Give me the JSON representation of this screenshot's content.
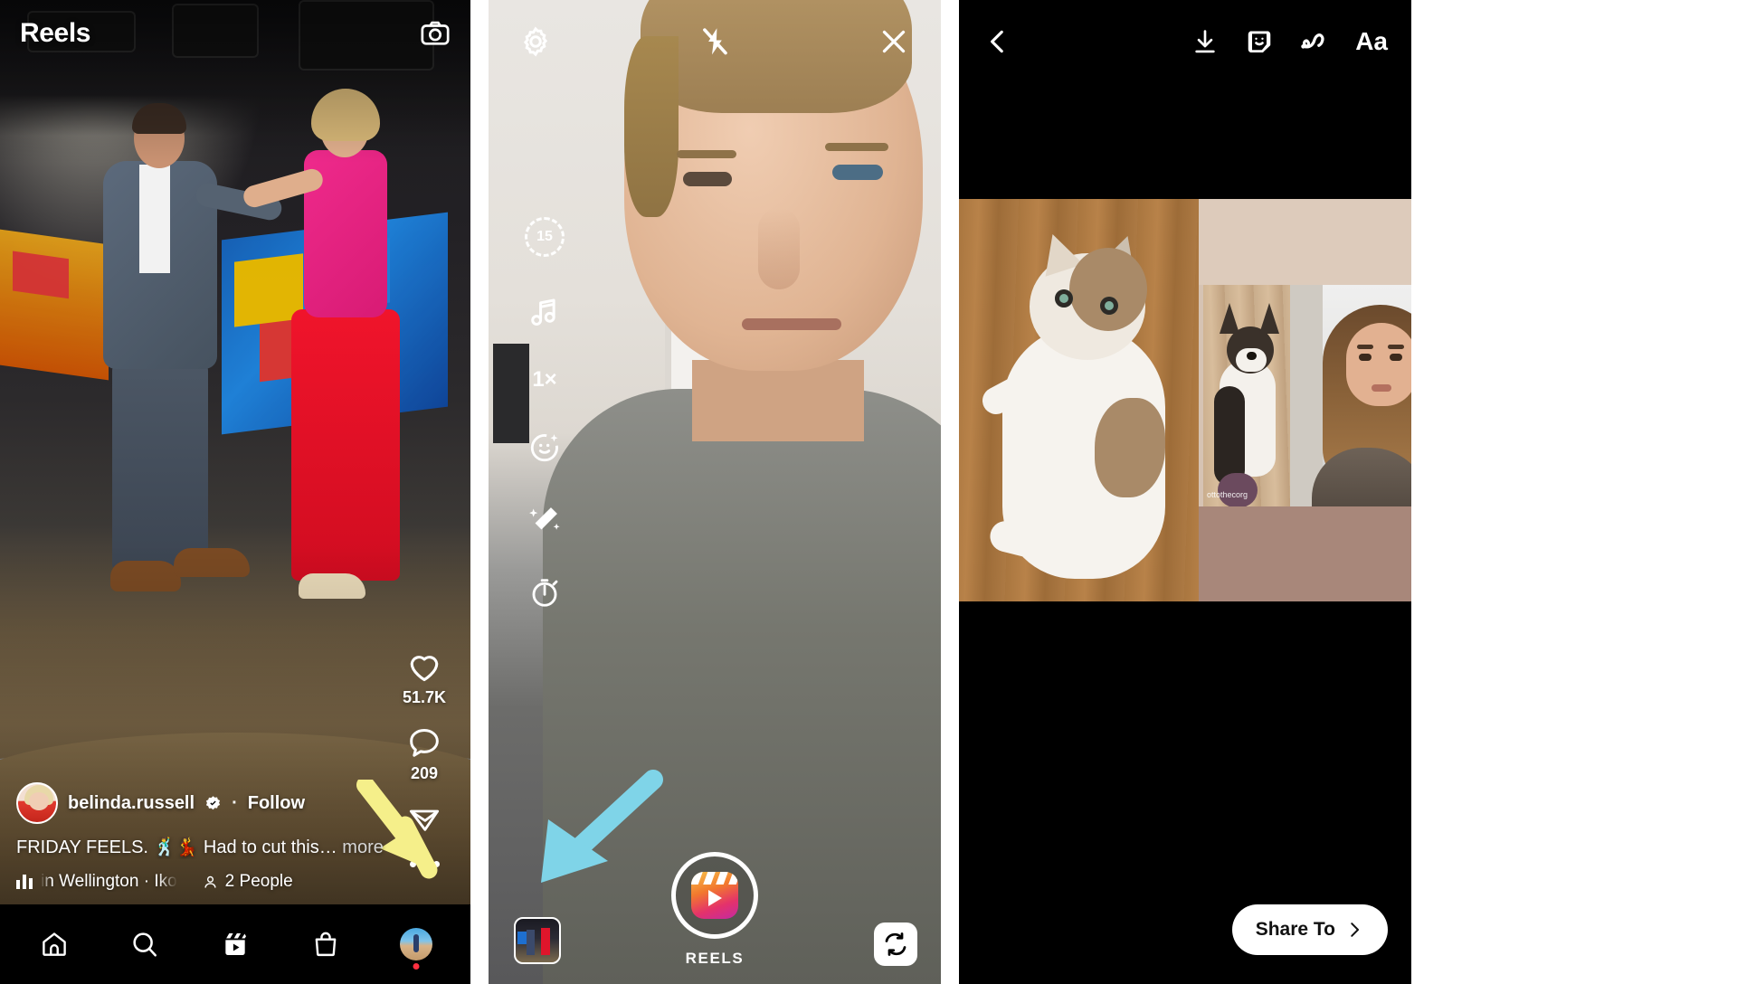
{
  "feed": {
    "title": "Reels",
    "camera_icon": "camera-icon",
    "post": {
      "username": "belinda.russell",
      "verified_icon": "verified-badge-icon",
      "separator": "·",
      "follow_label": "Follow",
      "caption": "FRIDAY FEELS. 🕺💃 Had to cut this… ",
      "caption_more": "more",
      "audio_text": "in Wellington · Iko",
      "audio_icon": "audio-equalizer-icon",
      "people_tag": "2 People",
      "people_icon": "person-icon"
    },
    "actions": {
      "like_icon": "heart-icon",
      "like_count": "51.7K",
      "comment_icon": "comment-bubble-icon",
      "comment_count": "209",
      "share_icon": "share-paper-plane-icon",
      "more_icon": "more-options-dots-icon"
    },
    "tabbar": [
      {
        "name": "home",
        "icon": "home-icon"
      },
      {
        "name": "search",
        "icon": "search-icon"
      },
      {
        "name": "reels",
        "icon": "reels-icon"
      },
      {
        "name": "shop",
        "icon": "shop-bag-icon"
      },
      {
        "name": "profile",
        "icon": "profile-avatar-icon"
      }
    ],
    "annotation": {
      "arrow": "yellow-arrow-pointing-to-more-options",
      "color": "#f5ef8a"
    }
  },
  "camera": {
    "top": {
      "settings_icon": "gear-icon",
      "flash_icon": "flash-off-icon",
      "close_icon": "close-x-icon"
    },
    "tools": [
      {
        "name": "duration",
        "icon": "duration-dashed-circle-icon",
        "value": "15"
      },
      {
        "name": "audio",
        "icon": "music-note-icon"
      },
      {
        "name": "speed",
        "icon": "speed-text",
        "value": "1×"
      },
      {
        "name": "effects",
        "icon": "effects-smiley-sparkle-icon"
      },
      {
        "name": "enhance",
        "icon": "magic-wand-icon"
      },
      {
        "name": "timer",
        "icon": "stopwatch-timer-icon"
      }
    ],
    "bottom": {
      "gallery_icon": "gallery-thumbnail",
      "record_icon": "reels-record-button",
      "mode_label": "REELS",
      "flip_icon": "flip-camera-icon"
    },
    "annotation": {
      "arrow": "blue-arrow-pointing-to-gallery-thumbnail",
      "color": "#7fd4e8"
    }
  },
  "editor": {
    "top": {
      "back_icon": "back-chevron-icon",
      "download_icon": "download-icon",
      "sticker_icon": "sticker-icon",
      "draw_icon": "draw-squiggle-icon",
      "text_label": "Aa"
    },
    "collage": {
      "left_media": "cat-on-wood-floor",
      "right_top_media": "corgi-dog-clip",
      "right_watermark": "ottothecorg",
      "right_media": "woman-talking-clip"
    },
    "share_button": {
      "label": "Share To",
      "chevron_icon": "chevron-right-icon"
    }
  }
}
